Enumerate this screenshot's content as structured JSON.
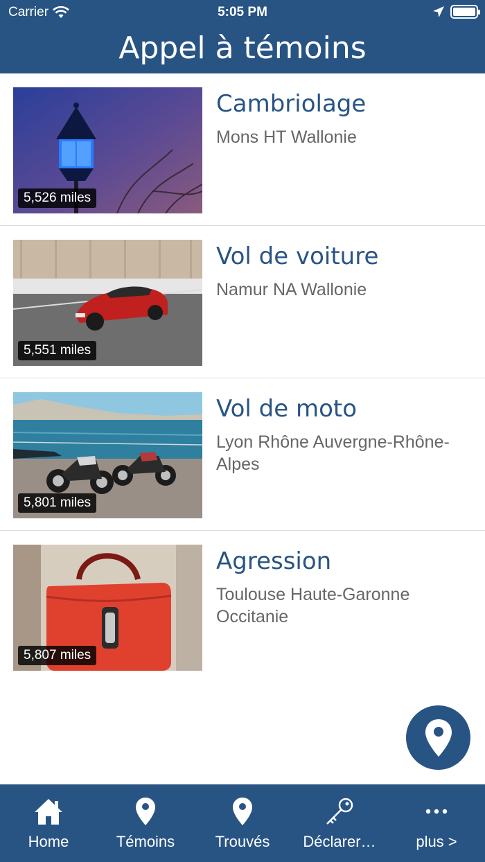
{
  "status_bar": {
    "carrier": "Carrier",
    "time": "5:05 PM"
  },
  "header": {
    "title": "Appel à témoins"
  },
  "items": [
    {
      "title": "Cambriolage",
      "location": "Mons HT Wallonie",
      "distance": "5,526 miles"
    },
    {
      "title": "Vol de voiture",
      "location": "Namur NA Wallonie",
      "distance": "5,551 miles"
    },
    {
      "title": "Vol de moto",
      "location": "Lyon Rhône Auvergne-Rhône-Alpes",
      "distance": "5,801 miles"
    },
    {
      "title": "Agression",
      "location": "Toulouse Haute-Garonne Occitanie",
      "distance": "5,807 miles"
    }
  ],
  "tabs": [
    {
      "label": "Home",
      "icon": "home-icon"
    },
    {
      "label": "Témoins",
      "icon": "map-pin-icon"
    },
    {
      "label": "Trouvés",
      "icon": "map-pin-icon"
    },
    {
      "label": "Déclarer…",
      "icon": "key-icon"
    },
    {
      "label": "plus >",
      "icon": "more-icon"
    }
  ],
  "colors": {
    "brand": "#285484",
    "secondary_text": "#666666"
  }
}
